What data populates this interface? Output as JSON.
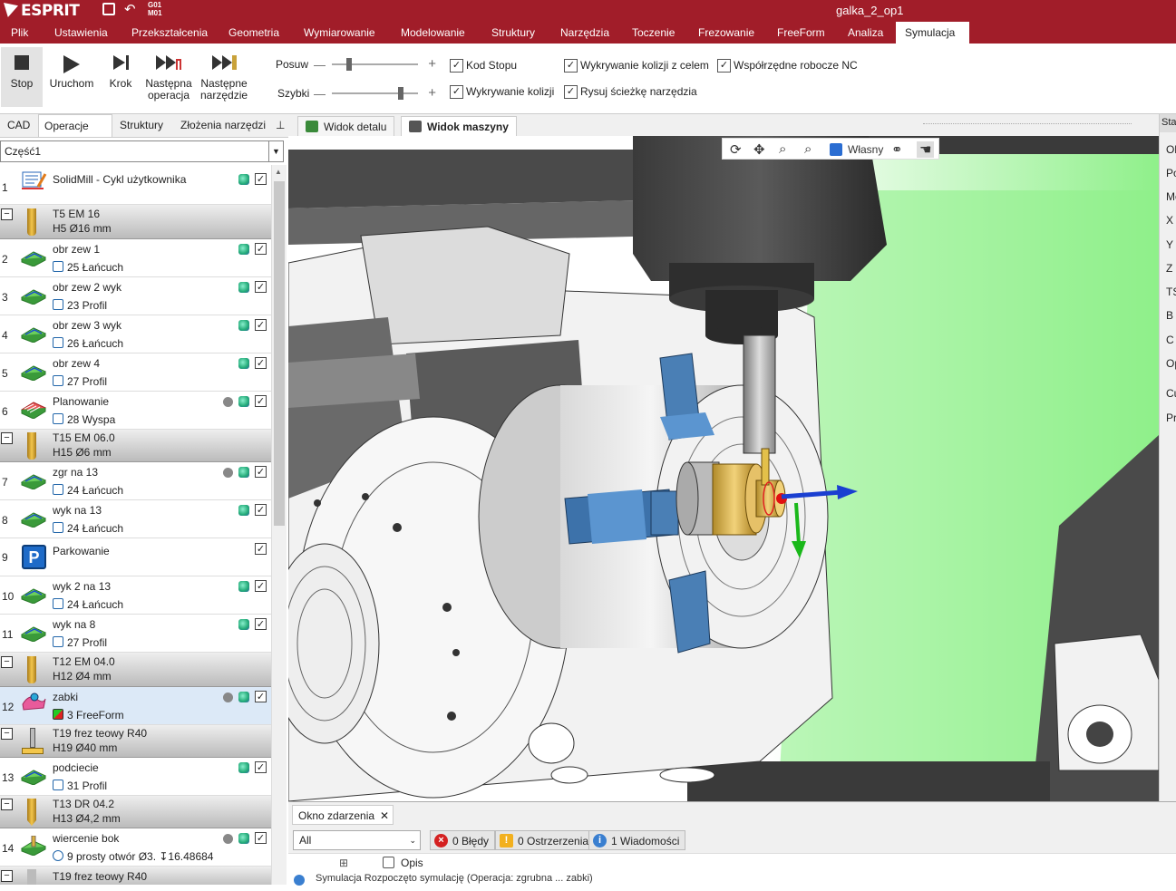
{
  "app": {
    "logo": "ESPRIT",
    "window_title": "galka_2_op1",
    "qa_g": "G01",
    "qa_m": "M01"
  },
  "menu": [
    {
      "label": "Plik"
    },
    {
      "label": "Ustawienia"
    },
    {
      "label": "Przekształcenia"
    },
    {
      "label": "Geometria"
    },
    {
      "label": "Wymiarowanie"
    },
    {
      "label": "Modelowanie"
    },
    {
      "label": "Struktury"
    },
    {
      "label": "Narzędzia"
    },
    {
      "label": "Toczenie"
    },
    {
      "label": "Frezowanie"
    },
    {
      "label": "FreeForm"
    },
    {
      "label": "Analiza"
    },
    {
      "label": "Symulacja"
    }
  ],
  "ribbon": {
    "stop": "Stop",
    "run": "Uruchom",
    "step": "Krok",
    "next_op_1": "Następna",
    "next_op_2": "operacja",
    "next_tool_1": "Następne",
    "next_tool_2": "narzędzie",
    "feed_label": "Posuw",
    "fast_label": "Szybki",
    "feed_level": 0.2,
    "fast_level": 0.8,
    "checks": {
      "stop_code": "Kod Stopu",
      "collision_target": "Wykrywanie kolizji z celem",
      "nc_coords": "Współrzędne robocze NC",
      "collision": "Wykrywanie kolizji",
      "toolpath": "Rysuj ścieżkę narzędzia"
    }
  },
  "left_tabs": {
    "cad": "CAD",
    "ops": "Operacje",
    "close": "✕",
    "struct": "Struktury",
    "tools": "Złożenia narzędzi",
    "pin": "⊥"
  },
  "part_select": "Część1",
  "ops": {
    "r1": {
      "num": "1",
      "title": "SolidMill - Cykl użytkownika"
    },
    "t5": {
      "title": "T5  EM 16",
      "sub": "H5  Ø16 mm"
    },
    "r2": {
      "num": "2",
      "title": "obr zew 1",
      "sub": "25 Łańcuch"
    },
    "r3": {
      "num": "3",
      "title": "obr zew 2 wyk",
      "sub": "23 Profil"
    },
    "r4": {
      "num": "4",
      "title": "obr zew 3 wyk",
      "sub": "26 Łańcuch"
    },
    "r5": {
      "num": "5",
      "title": "obr zew 4",
      "sub": "27 Profil"
    },
    "r6": {
      "num": "6",
      "title": "Planowanie",
      "sub": "28 Wyspa"
    },
    "t15": {
      "title": "T15  EM 06.0",
      "sub": "H15  Ø6 mm"
    },
    "r7": {
      "num": "7",
      "title": "zgr na 13",
      "sub": "24 Łańcuch"
    },
    "r8": {
      "num": "8",
      "title": "wyk na 13",
      "sub": "24 Łańcuch"
    },
    "r9": {
      "num": "9",
      "title": "Parkowanie",
      "icon_letter": "P"
    },
    "r10": {
      "num": "10",
      "title": "wyk 2 na 13",
      "sub": "24 Łańcuch"
    },
    "r11": {
      "num": "11",
      "title": "wyk na 8",
      "sub": "27 Profil"
    },
    "t12": {
      "title": "T12  EM 04.0",
      "sub": "H12  Ø4 mm"
    },
    "r12": {
      "num": "12",
      "title": "zabki",
      "sub": "3 FreeForm"
    },
    "t19": {
      "title": "T19  frez teowy R40",
      "sub": "H19  Ø40 mm"
    },
    "r13": {
      "num": "13",
      "title": "podciecie",
      "sub": "31 Profil"
    },
    "t13": {
      "title": "T13  DR 04.2",
      "sub": "H13  Ø4,2 mm"
    },
    "r14": {
      "num": "14",
      "title": "wiercenie bok",
      "sub": "9 prosty otwór Ø3. ↧16.48684"
    },
    "t19b": {
      "title": "T19  frez teowy R40"
    }
  },
  "view_tabs": {
    "detail": "Widok detalu",
    "machine": "Widok maszyny"
  },
  "view_toolbar": {
    "custom": "Własny"
  },
  "events": {
    "tab": "Okno zdarzenia",
    "close": "✕",
    "filter": "All",
    "errors": "0 Błędy",
    "warnings": "0 Ostrzerzenia",
    "messages": "1 Wiadomości",
    "col_desc": "Opis",
    "row_text": "Symulacja        Rozpoczęto symulację (Operacja: zgrubna ... zabki)"
  },
  "right_panel": [
    "Ob",
    "Po",
    "Mo",
    "X",
    "Y",
    "Z",
    "TS",
    "B",
    "C",
    "Op",
    "Cu",
    "Pr"
  ],
  "colors": {
    "brand": "#a11d29",
    "selected_row": "#dce9f7",
    "axis_x": "#1a3fd1",
    "axis_z": "#1ab81a"
  }
}
